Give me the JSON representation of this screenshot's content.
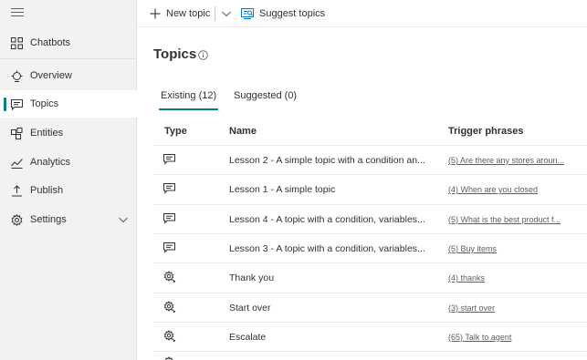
{
  "sidebar": {
    "items": [
      {
        "label": "Chatbots"
      },
      {
        "label": "Overview"
      },
      {
        "label": "Topics"
      },
      {
        "label": "Entities"
      },
      {
        "label": "Analytics"
      },
      {
        "label": "Publish"
      },
      {
        "label": "Settings"
      }
    ]
  },
  "toolbar": {
    "new_topic_label": "New topic",
    "suggest_topics_label": "Suggest topics"
  },
  "page": {
    "title": "Topics"
  },
  "tabs": [
    {
      "label": "Existing (12)"
    },
    {
      "label": "Suggested (0)"
    }
  ],
  "table": {
    "columns": [
      "Type",
      "Name",
      "Trigger phrases"
    ],
    "rows": [
      {
        "type_icon": "chat-icon",
        "name": "Lesson 2 - A simple topic with a condition an...",
        "trigger": "(5) Are there any stores aroun..."
      },
      {
        "type_icon": "chat-icon",
        "name": "Lesson 1 - A simple topic",
        "trigger": "(4) When are you closed"
      },
      {
        "type_icon": "chat-icon",
        "name": "Lesson 4 - A topic with a condition, variables...",
        "trigger": "(5) What is the best product f..."
      },
      {
        "type_icon": "chat-icon",
        "name": "Lesson 3 - A topic with a condition, variables...",
        "trigger": "(5) Buy items"
      },
      {
        "type_icon": "system-topic-icon",
        "name": "Thank you",
        "trigger": "(4) thanks"
      },
      {
        "type_icon": "system-topic-icon",
        "name": "Start over",
        "trigger": "(3) start over"
      },
      {
        "type_icon": "system-topic-icon",
        "name": "Escalate",
        "trigger": "(65) Talk to agent"
      }
    ]
  },
  "colors": {
    "accent": "#107c81",
    "sidebar_bg": "#f3f2f1",
    "suggest_icon": "#0078d4"
  }
}
